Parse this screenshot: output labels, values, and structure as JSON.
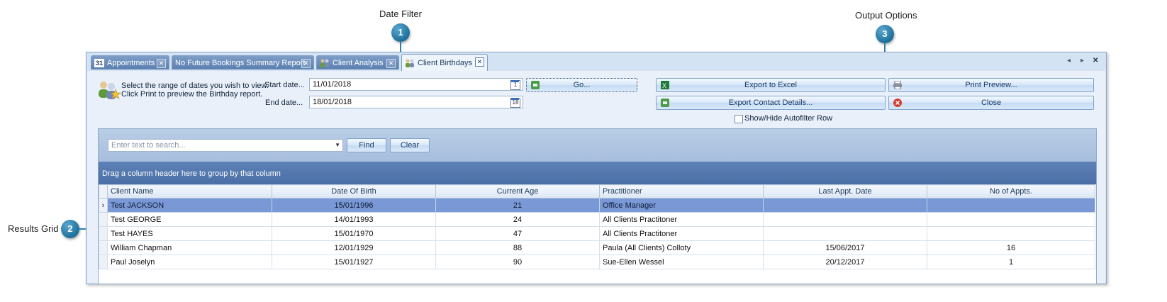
{
  "callouts": [
    {
      "number": "1",
      "label": "Date Filter"
    },
    {
      "number": "2",
      "label": "Results Grid"
    },
    {
      "number": "3",
      "label": "Output Options"
    }
  ],
  "tabs": [
    {
      "label": "Appointments",
      "icon": "calendar-31-icon",
      "icon_text": "31"
    },
    {
      "label": "No Future Bookings Summary Report",
      "icon": "",
      "icon_text": ""
    },
    {
      "label": "Client Analysis",
      "icon": "people-icon",
      "icon_text": ""
    },
    {
      "label": "Client Birthdays",
      "icon": "people-icon",
      "icon_text": ""
    }
  ],
  "tab_nav": {
    "prev": "◂",
    "next": "▸",
    "close": "✕"
  },
  "filter": {
    "instructions_line1": "Select the range of dates you wish to view.",
    "instructions_line2": "Click Print to preview the Birthday report.",
    "start_label": "Start date...",
    "start_value": "11/01/2018",
    "start_cal": "1",
    "end_label": "End date...",
    "end_value": "18/01/2018",
    "end_cal": "18",
    "go_label": "Go..."
  },
  "output": {
    "export_excel": "Export to Excel",
    "print_preview": "Print Preview...",
    "export_contact": "Export Contact Details...",
    "close": "Close",
    "autofilter_label": "Show/Hide Autofilter Row"
  },
  "search": {
    "placeholder": "Enter text to search...",
    "find_label": "Find",
    "clear_label": "Clear",
    "group_hint": "Drag a column header here to group by that column"
  },
  "grid": {
    "columns": [
      "Client Name",
      "Date Of Birth",
      "Current Age",
      "Practitioner",
      "Last Appt. Date",
      "No of Appts."
    ],
    "rows": [
      {
        "indicator": "›",
        "name": "Test JACKSON",
        "dob": "15/01/1996",
        "age": "21",
        "practitioner": "Office Manager",
        "last": "",
        "count": ""
      },
      {
        "indicator": "",
        "name": "Test GEORGE",
        "dob": "14/01/1993",
        "age": "24",
        "practitioner": "All Clients Practitoner",
        "last": "",
        "count": ""
      },
      {
        "indicator": "",
        "name": "Test HAYES",
        "dob": "15/01/1970",
        "age": "47",
        "practitioner": "All Clients Practitoner",
        "last": "",
        "count": ""
      },
      {
        "indicator": "",
        "name": "William Chapman",
        "dob": "12/01/1929",
        "age": "88",
        "practitioner": "Paula (All Clients) Colloty",
        "last": "15/06/2017",
        "count": "16"
      },
      {
        "indicator": "",
        "name": "Paul Joselyn",
        "dob": "15/01/1927",
        "age": "90",
        "practitioner": "Sue-Ellen  Wessel",
        "last": "20/12/2017",
        "count": "1"
      }
    ]
  },
  "colors": {
    "accent": "#1e6f9c",
    "selected_row": "#7a98d6",
    "group_panel": "#4a6fa6"
  }
}
